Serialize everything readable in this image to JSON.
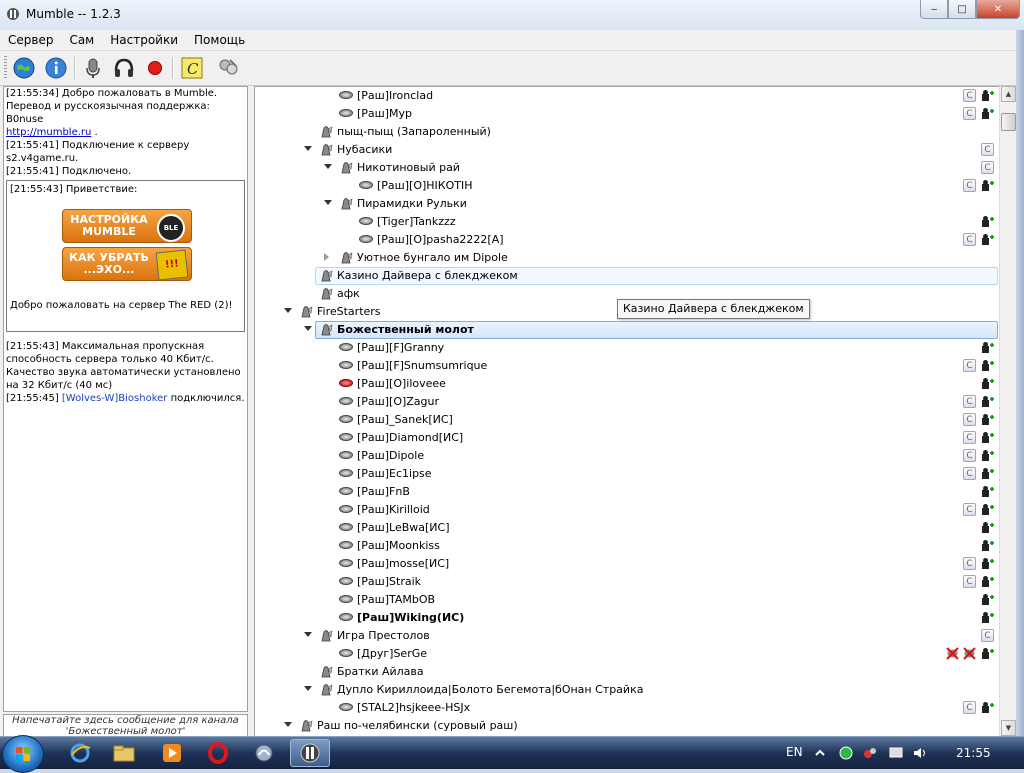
{
  "window": {
    "title": "Mumble -- 1.2.3",
    "minimize": "‒",
    "maximize": "□",
    "close": "✕"
  },
  "menu": [
    "Сервер",
    "Сам",
    "Настройки",
    "Помощь"
  ],
  "toolbar": {
    "buttons": [
      "globe-connect-icon",
      "info-icon",
      "microphone-mute-icon",
      "headphones-deafen-icon",
      "record-icon",
      "comment-c-icon",
      "configure-users-icon"
    ]
  },
  "log": {
    "lines": [
      "[21:55:34] Добро пожаловать в Mumble.",
      "Перевод и русскоязычная поддержка: B0nuse",
      "http://mumble.ru",
      " .",
      "[21:55:41] Подключение к серверу s2.v4game.ru.",
      "[21:55:41] Подключено."
    ],
    "welcome_title": "[21:55:43] Приветствие:",
    "banner1": "НАСТРОЙКА MUMBLE",
    "banner1_badge": "BLE",
    "banner2": "КАК УБРАТЬ ...ЭХО...",
    "banner2_sign": "!!!",
    "welcome_footer": "Добро пожаловать на сервер The RED (2)!",
    "bandwidth": "[21:55:43] Максимальная пропускная способность сервера только 40 Кбит/с. Качество звука автоматически установлено на 32 Кбит/с (40 мс)",
    "join_time": "[21:55:45] ",
    "join_user": "[Wolves-W]Bioshoker",
    "join_text": " подключился."
  },
  "chat_input": {
    "placeholder": "Напечатайте здесь сообщение для канала 'Божественный молот'"
  },
  "tree": [
    {
      "type": "user",
      "label": "[Раш]Ironclad",
      "comment": true,
      "registered": true
    },
    {
      "type": "user",
      "label": "[Раш]Мур",
      "comment": true,
      "registered": true
    },
    {
      "type": "channel",
      "label": "пыщ-пыщ (Запароленный)"
    },
    {
      "type": "channel",
      "label": "Нубасики",
      "comment": true
    },
    {
      "type": "channel",
      "label": "Никотиновый рай",
      "comment": true
    },
    {
      "type": "user",
      "label": "[Раш][О]НIКОТIН",
      "comment": true,
      "registered": true
    },
    {
      "type": "channel",
      "label": "Пирамидки Рульки"
    },
    {
      "type": "user",
      "label": "[Tiger]Tankzzz",
      "registered": true
    },
    {
      "type": "user",
      "label": "[Раш][О]pasha2222[А]",
      "comment": true,
      "registered": true
    },
    {
      "type": "channel",
      "label": "Уютное бунгало им Dipole"
    },
    {
      "type": "channel",
      "label": "Казино Дайвера с блекджеком"
    },
    {
      "type": "channel",
      "label": "афк"
    },
    {
      "type": "channel",
      "label": "FireStarters"
    },
    {
      "type": "channel",
      "label": "Божественный молот"
    },
    {
      "type": "user",
      "label": "[Раш][F]Granny",
      "registered": true
    },
    {
      "type": "user",
      "label": "[Раш][F]Snumsumrique",
      "comment": true,
      "registered": true
    },
    {
      "type": "user",
      "label": "[Раш][О]iloveee",
      "registered": true
    },
    {
      "type": "user",
      "label": "[Раш][О]Zagur",
      "comment": true,
      "registered": true
    },
    {
      "type": "user",
      "label": "[Раш]_Sanek[ИС]",
      "comment": true,
      "registered": true
    },
    {
      "type": "user",
      "label": "[Раш]Diamond[ИС]",
      "comment": true,
      "registered": true
    },
    {
      "type": "user",
      "label": "[Раш]Dipole",
      "comment": true,
      "registered": true
    },
    {
      "type": "user",
      "label": "[Раш]Ec1ipse",
      "comment": true,
      "registered": true
    },
    {
      "type": "user",
      "label": "[Раш]FnB",
      "registered": true
    },
    {
      "type": "user",
      "label": "[Раш]Kirilloid",
      "comment": true,
      "registered": true
    },
    {
      "type": "user",
      "label": "[Раш]LeBwa[ИС]",
      "registered": true
    },
    {
      "type": "user",
      "label": "[Раш]Moonkiss",
      "registered": true
    },
    {
      "type": "user",
      "label": "[Раш]mosse[ИС]",
      "comment": true,
      "registered": true
    },
    {
      "type": "user",
      "label": "[Раш]Straik",
      "comment": true,
      "registered": true
    },
    {
      "type": "user",
      "label": "[Раш]TAMbOB",
      "registered": true
    },
    {
      "type": "user",
      "label": "[Раш]Wiking(ИС)",
      "registered": true
    },
    {
      "type": "channel",
      "label": "Игра Престолов",
      "comment": true
    },
    {
      "type": "user",
      "label": "[Друг]SerGe",
      "muted": true,
      "deafened": true,
      "registered": true
    },
    {
      "type": "channel",
      "label": "Братки Айлава"
    },
    {
      "type": "channel",
      "label": "Дупло Кириллоида|Болото Бегемота|бОнан Страйка"
    },
    {
      "type": "user",
      "label": "[STAL2]hsjkeee-HSJx",
      "comment": true,
      "registered": true
    },
    {
      "type": "channel",
      "label": "Раш по-челябински (суровый раш)"
    }
  ],
  "tooltip": "Казино Дайвера с блекджеком",
  "comment_glyph": "C",
  "taskbar": {
    "language": "EN",
    "clock": "21:55",
    "apps": [
      "explorer-ie-icon",
      "folder-icon",
      "media-player-icon",
      "opera-icon",
      "app-icon",
      "mumble-icon"
    ]
  }
}
